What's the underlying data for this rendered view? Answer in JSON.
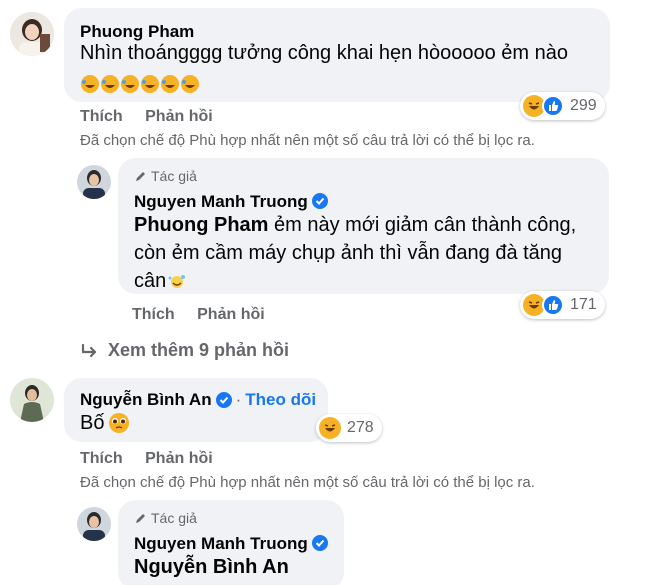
{
  "comments": [
    {
      "author": "Phuong Pham",
      "text": "Nhìn thoángggg tưởng công khai hẹn hòooooo ẻm nào",
      "emoji_row": "🤣🤣🤣🤣🤣🤣",
      "reaction_count": "299",
      "actions": {
        "like": "Thích",
        "reply": "Phản hồi"
      },
      "filter_notice": "Đã chọn chế độ Phù hợp nhất nên một số câu trả lời có thể bị lọc ra."
    },
    {
      "author_tag": "Tác giả",
      "author": "Nguyen Manh Truong",
      "mention": "Phuong Pham",
      "text_line1": " ẻm này mới giảm cân thành công,",
      "text_line2": "còn ẻm cầm máy chụp ảnh thì vẫn đang đà tăng",
      "text_line3": "cân",
      "reaction_count": "171",
      "actions": {
        "like": "Thích",
        "reply": "Phản hồi"
      }
    },
    {
      "more_replies": "Xem thêm 9 phản hồi"
    },
    {
      "author": "Nguyễn Bình An",
      "follow": "Theo dõi",
      "separator": "·",
      "text": "Bố",
      "reaction_count": "278",
      "actions": {
        "like": "Thích",
        "reply": "Phản hồi"
      },
      "filter_notice": "Đã chọn chế độ Phù hợp nhất nên một số câu trả lời có thể bị lọc ra."
    },
    {
      "author_tag": "Tác giả",
      "author": "Nguyen Manh Truong",
      "mention": "Nguyễn Bình An"
    }
  ],
  "colors": {
    "bubble": "#f0f2f5",
    "secondary_text": "#65676b",
    "link": "#1877f2",
    "reaction_yellow": "#f7b125"
  },
  "icons": [
    "haha-reaction-icon",
    "like-reaction-icon",
    "verified-badge-icon",
    "pencil-icon",
    "reply-arrow-icon",
    "pleading-face-emoji",
    "sweat-smile-emoji"
  ]
}
